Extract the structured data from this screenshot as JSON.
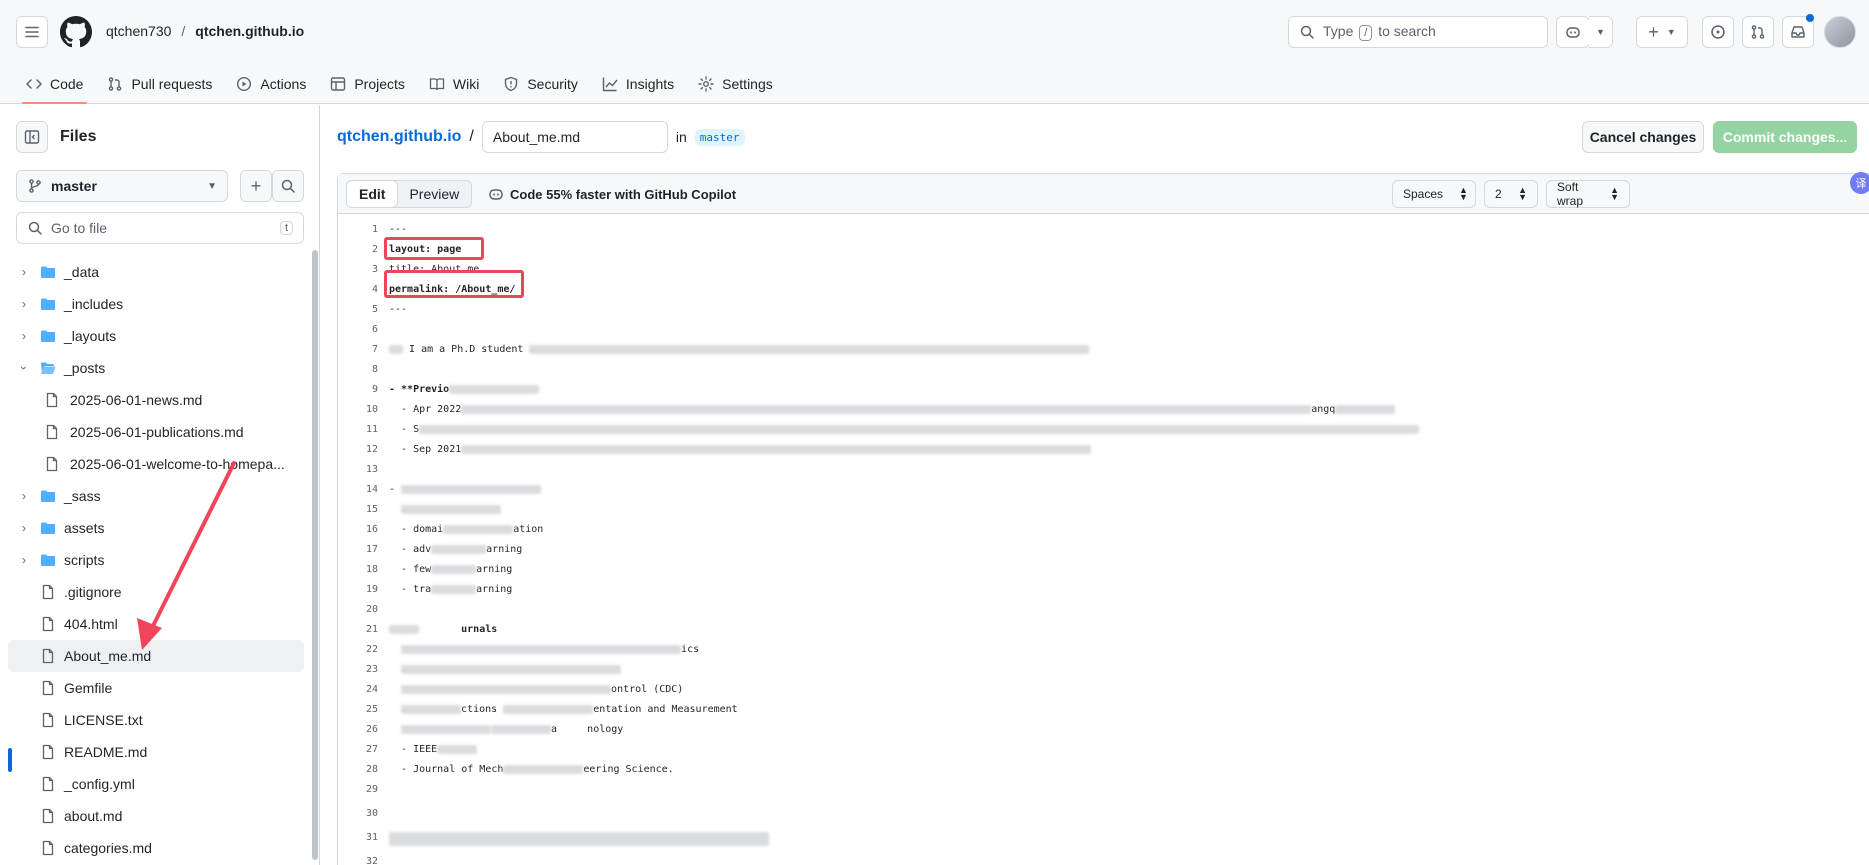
{
  "header": {
    "owner": "qtchen730",
    "separator": "/",
    "repo": "qtchen.github.io",
    "search_prefix": "Type",
    "search_key": "/",
    "search_suffix": "to search"
  },
  "nav": {
    "code": "Code",
    "pulls": "Pull requests",
    "actions": "Actions",
    "projects": "Projects",
    "wiki": "Wiki",
    "security": "Security",
    "insights": "Insights",
    "settings": "Settings"
  },
  "sidebar": {
    "title": "Files",
    "branch": "master",
    "goto_placeholder": "Go to file",
    "goto_key": "t",
    "items": [
      {
        "label": "_data"
      },
      {
        "label": "_includes"
      },
      {
        "label": "_layouts"
      },
      {
        "label": "_posts"
      },
      {
        "label": "2025-06-01-news.md"
      },
      {
        "label": "2025-06-01-publications.md"
      },
      {
        "label": "2025-06-01-welcome-to-homepa..."
      },
      {
        "label": "_sass"
      },
      {
        "label": "assets"
      },
      {
        "label": "scripts"
      },
      {
        "label": ".gitignore"
      },
      {
        "label": "404.html"
      },
      {
        "label": "About_me.md"
      },
      {
        "label": "Gemfile"
      },
      {
        "label": "LICENSE.txt"
      },
      {
        "label": "README.md"
      },
      {
        "label": "_config.yml"
      },
      {
        "label": "about.md"
      },
      {
        "label": "categories.md"
      }
    ]
  },
  "editor": {
    "repo_link": "qtchen.github.io",
    "path_sep": "/",
    "filename": "About_me.md",
    "in_label": "in",
    "branch": "master",
    "cancel": "Cancel changes",
    "commit": "Commit changes...",
    "tab_edit": "Edit",
    "tab_preview": "Preview",
    "copilot": "Code 55% faster with GitHub Copilot",
    "indent_mode": "Spaces",
    "indent_size": "2",
    "wrap_mode": "Soft wrap"
  },
  "code": {
    "lines": [
      {
        "n": "1",
        "text": "---"
      },
      {
        "n": "2",
        "text": "layout: page"
      },
      {
        "n": "3",
        "text": "title: About me"
      },
      {
        "n": "4",
        "text": "permalink: /About_me/"
      },
      {
        "n": "5",
        "text": "---"
      },
      {
        "n": "6",
        "text": ""
      },
      {
        "n": "7",
        "text": "I am a Ph.D student"
      },
      {
        "n": "8",
        "text": ""
      },
      {
        "n": "9",
        "text": "- **Previo"
      },
      {
        "n": "10",
        "text": "  - Apr 2022"
      },
      {
        "n": "11",
        "text": "  - S"
      },
      {
        "n": "12",
        "text": "  - Sep 2021"
      },
      {
        "n": "13",
        "text": ""
      },
      {
        "n": "14",
        "text": "-"
      },
      {
        "n": "15",
        "text": ""
      },
      {
        "n": "16",
        "text": "  - domai"
      },
      {
        "n": "17",
        "text": "  - adv"
      },
      {
        "n": "18",
        "text": "  - few"
      },
      {
        "n": "19",
        "text": "  - tra"
      },
      {
        "n": "20",
        "text": ""
      },
      {
        "n": "21",
        "text": "       urnals"
      },
      {
        "n": "22",
        "text": ""
      },
      {
        "n": "23",
        "text": ""
      },
      {
        "n": "24",
        "text": ""
      },
      {
        "n": "25",
        "text": ""
      },
      {
        "n": "26",
        "text": ""
      },
      {
        "n": "27",
        "text": "  - IEEE"
      },
      {
        "n": "28",
        "text": "  - Journal of Mech"
      },
      {
        "n": "29",
        "text": ""
      },
      {
        "n": "30",
        "text": ""
      },
      {
        "n": "31",
        "text": ""
      },
      {
        "n": "32",
        "text": ""
      }
    ],
    "tails": {
      "7": "",
      "10": "angq",
      "16": "ation",
      "17": "arning",
      "18": "arning",
      "19": "arning",
      "21": "ics",
      "24": "ontrol (CDC)",
      "25": "ctions",
      "25b": "entation and Measurement",
      "26": "a     nology",
      "28": "eering Science."
    }
  }
}
